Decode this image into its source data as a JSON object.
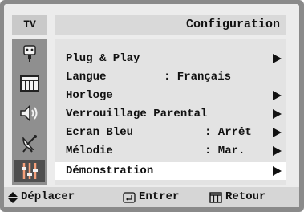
{
  "header": {
    "tv_label": "TV",
    "title": "Configuration"
  },
  "sidebar": {
    "items": [
      {
        "icon": "input-source-icon",
        "active": false
      },
      {
        "icon": "picture-icon",
        "active": false
      },
      {
        "icon": "sound-icon",
        "active": false
      },
      {
        "icon": "channel-antenna-icon",
        "active": false
      },
      {
        "icon": "setup-sliders-icon",
        "active": true
      }
    ]
  },
  "menu": {
    "items": [
      {
        "label": "Plug & Play",
        "value": "",
        "arrow": true,
        "selected": false
      },
      {
        "label": "Langue",
        "value": ": Français",
        "arrow": false,
        "selected": false
      },
      {
        "label": "Horloge",
        "value": "",
        "arrow": true,
        "selected": false
      },
      {
        "label": "Verrouillage Parental",
        "value": "",
        "arrow": true,
        "selected": false
      },
      {
        "label": "Ecran Bleu",
        "value": ": Arrêt",
        "arrow": true,
        "selected": false
      },
      {
        "label": "Mélodie",
        "value": ": Mar.",
        "arrow": true,
        "selected": false
      },
      {
        "label": "Démonstration",
        "value": "",
        "arrow": true,
        "selected": true
      }
    ]
  },
  "footer": {
    "move_label": "Déplacer",
    "enter_label": "Entrer",
    "return_label": "Retour"
  }
}
